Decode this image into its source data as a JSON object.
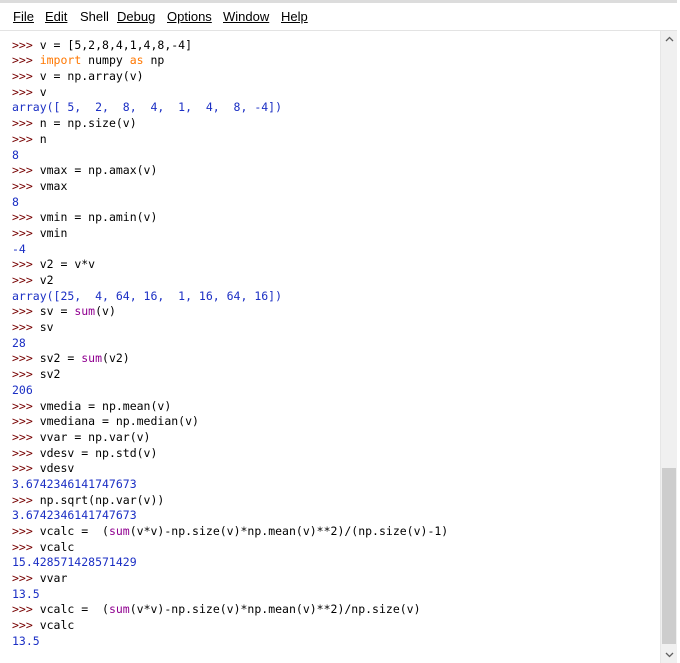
{
  "menu": [
    "File",
    "Edit",
    "Shell",
    "Debug",
    "Options",
    "Window",
    "Help"
  ],
  "shell_lines": [
    {
      "type": "top",
      "text": "ˇˇˇ"
    },
    {
      "type": "in",
      "segments": [
        {
          "c": "code",
          "t": "v = [5,2,8,4,1,4,8,-4]"
        }
      ]
    },
    {
      "type": "in",
      "segments": [
        {
          "c": "kw",
          "t": "import"
        },
        {
          "c": "code",
          "t": " numpy "
        },
        {
          "c": "kw",
          "t": "as"
        },
        {
          "c": "code",
          "t": " np"
        }
      ]
    },
    {
      "type": "in",
      "segments": [
        {
          "c": "code",
          "t": "v = np.array(v)"
        }
      ]
    },
    {
      "type": "in",
      "segments": [
        {
          "c": "code",
          "t": "v"
        }
      ]
    },
    {
      "type": "out",
      "text": "array([ 5,  2,  8,  4,  1,  4,  8, -4])"
    },
    {
      "type": "in",
      "segments": [
        {
          "c": "code",
          "t": "n = np.size(v)"
        }
      ]
    },
    {
      "type": "in",
      "segments": [
        {
          "c": "code",
          "t": "n"
        }
      ]
    },
    {
      "type": "out",
      "text": "8"
    },
    {
      "type": "in",
      "segments": [
        {
          "c": "code",
          "t": "vmax = np.amax(v)"
        }
      ]
    },
    {
      "type": "in",
      "segments": [
        {
          "c": "code",
          "t": "vmax"
        }
      ]
    },
    {
      "type": "out",
      "text": "8"
    },
    {
      "type": "in",
      "segments": [
        {
          "c": "code",
          "t": "vmin = np.amin(v)"
        }
      ]
    },
    {
      "type": "in",
      "segments": [
        {
          "c": "code",
          "t": "vmin"
        }
      ]
    },
    {
      "type": "out",
      "text": "-4"
    },
    {
      "type": "in",
      "segments": [
        {
          "c": "code",
          "t": "v2 = v*v"
        }
      ]
    },
    {
      "type": "in",
      "segments": [
        {
          "c": "code",
          "t": "v2"
        }
      ]
    },
    {
      "type": "out",
      "text": "array([25,  4, 64, 16,  1, 16, 64, 16])"
    },
    {
      "type": "in",
      "segments": [
        {
          "c": "code",
          "t": "sv = "
        },
        {
          "c": "bi",
          "t": "sum"
        },
        {
          "c": "code",
          "t": "(v)"
        }
      ]
    },
    {
      "type": "in",
      "segments": [
        {
          "c": "code",
          "t": "sv"
        }
      ]
    },
    {
      "type": "out",
      "text": "28"
    },
    {
      "type": "in",
      "segments": [
        {
          "c": "code",
          "t": "sv2 = "
        },
        {
          "c": "bi",
          "t": "sum"
        },
        {
          "c": "code",
          "t": "(v2)"
        }
      ]
    },
    {
      "type": "in",
      "segments": [
        {
          "c": "code",
          "t": "sv2"
        }
      ]
    },
    {
      "type": "out",
      "text": "206"
    },
    {
      "type": "in",
      "segments": [
        {
          "c": "code",
          "t": "vmedia = np.mean(v)"
        }
      ]
    },
    {
      "type": "in",
      "segments": [
        {
          "c": "code",
          "t": "vmediana = np.median(v)"
        }
      ]
    },
    {
      "type": "in",
      "segments": [
        {
          "c": "code",
          "t": "vvar = np.var(v)"
        }
      ]
    },
    {
      "type": "in",
      "segments": [
        {
          "c": "code",
          "t": "vdesv = np.std(v)"
        }
      ]
    },
    {
      "type": "in",
      "segments": [
        {
          "c": "code",
          "t": "vdesv"
        }
      ]
    },
    {
      "type": "out",
      "text": "3.6742346141747673"
    },
    {
      "type": "in",
      "segments": [
        {
          "c": "code",
          "t": "np.sqrt(np.var(v))"
        }
      ]
    },
    {
      "type": "out",
      "text": "3.6742346141747673"
    },
    {
      "type": "in",
      "segments": [
        {
          "c": "code",
          "t": "vcalc =  ("
        },
        {
          "c": "bi",
          "t": "sum"
        },
        {
          "c": "code",
          "t": "(v*v)-np.size(v)*np.mean(v)**2)/(np.size(v)-1)"
        }
      ]
    },
    {
      "type": "in",
      "segments": [
        {
          "c": "code",
          "t": "vcalc"
        }
      ]
    },
    {
      "type": "out",
      "text": "15.428571428571429"
    },
    {
      "type": "in",
      "segments": [
        {
          "c": "code",
          "t": "vvar"
        }
      ]
    },
    {
      "type": "out",
      "text": "13.5"
    },
    {
      "type": "in",
      "segments": [
        {
          "c": "code",
          "t": "vcalc =  ("
        },
        {
          "c": "bi",
          "t": "sum"
        },
        {
          "c": "code",
          "t": "(v*v)-np.size(v)*np.mean(v)**2)/np.size(v)"
        }
      ]
    },
    {
      "type": "in",
      "segments": [
        {
          "c": "code",
          "t": "vcalc"
        }
      ]
    },
    {
      "type": "out",
      "text": "13.5"
    }
  ],
  "prompt": ">>> ",
  "colors": {
    "prompt": "#770000",
    "output": "#1b2fc4",
    "keyword": "#ff7700",
    "builtin": "#900090"
  }
}
